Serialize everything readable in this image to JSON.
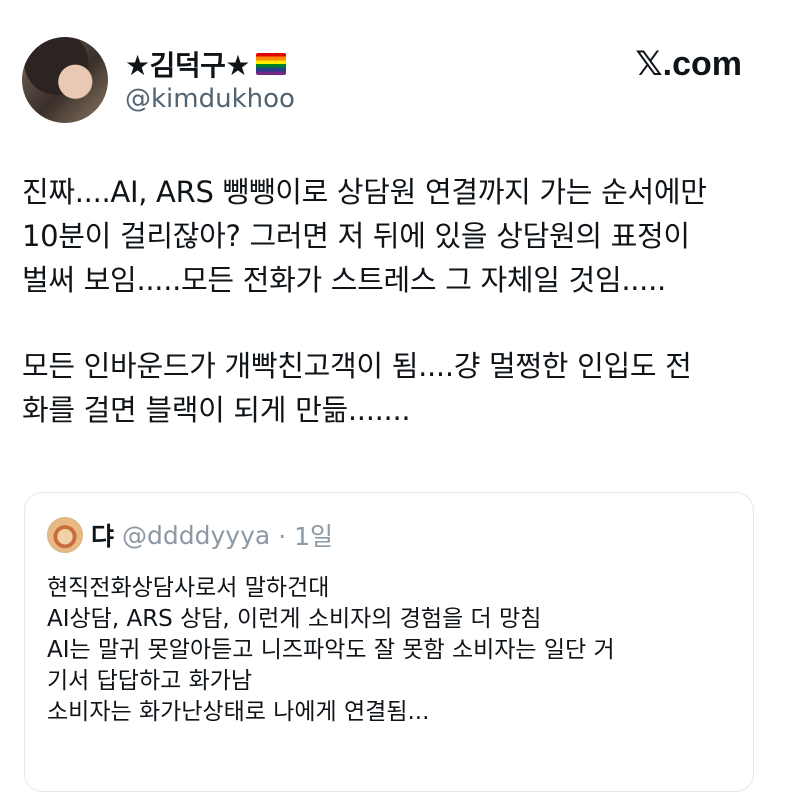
{
  "tweet": {
    "display_name": "★김덕구★",
    "flag_icon": "rainbow-flag-icon",
    "handle": "@kimdukhoo",
    "brand": "𝕏.com",
    "body_lines": [
      "진짜....AI, ARS 뺑뺑이로 상담원 연결까지 가는 순서에만",
      "10분이 걸리잖아? 그러면 저 뒤에 있을 상담원의 표정이",
      "벌써 보임.....모든 전화가 스트레스 그 자체일 것임.....",
      "",
      "모든 인바운드가 개빡친고객이 됨....걍 멀쩡한 인입도 전",
      "화를 걸면 블랙이 되게 만듦......."
    ]
  },
  "quote": {
    "name": "댜",
    "handle": "@ddddyyya",
    "time": "· 1일",
    "body_lines": [
      "현직전화상담사로서 말하건대",
      "AI상담, ARS 상담, 이런게 소비자의 경험을 더 망침",
      "AI는 말귀 못알아듣고 니즈파악도 잘 못함 소비자는 일단 거",
      "기서 답답하고 화가남",
      "소비자는 화가난상태로 나에게 연결됨..."
    ]
  }
}
